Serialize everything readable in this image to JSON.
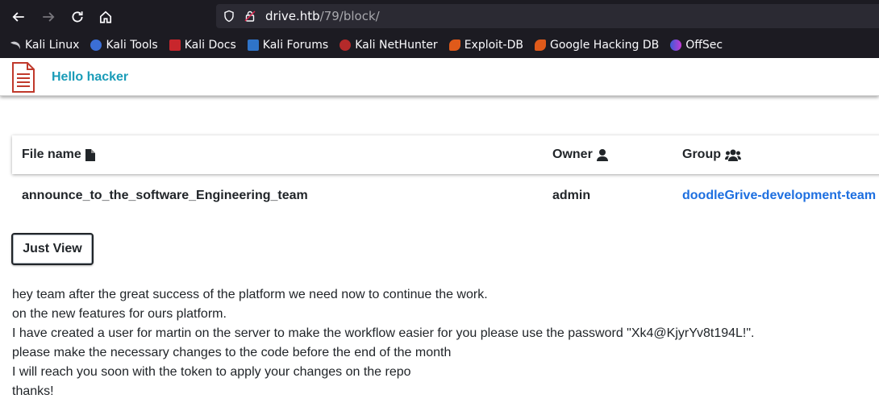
{
  "browser": {
    "url_host": "drive.htb",
    "url_path": "/79/block/",
    "bookmarks": [
      {
        "label": "Kali Linux",
        "icon": "kali-dragon-icon"
      },
      {
        "label": "Kali Tools",
        "icon": "kali-tools-icon"
      },
      {
        "label": "Kali Docs",
        "icon": "kali-docs-icon"
      },
      {
        "label": "Kali Forums",
        "icon": "kali-forums-icon"
      },
      {
        "label": "Kali NetHunter",
        "icon": "kali-nethunter-icon"
      },
      {
        "label": "Exploit-DB",
        "icon": "exploit-db-icon"
      },
      {
        "label": "Google Hacking DB",
        "icon": "ghdb-icon"
      },
      {
        "label": "OffSec",
        "icon": "offsec-icon"
      }
    ]
  },
  "header": {
    "greeting": "Hello hacker",
    "accent": "#1a9cb8"
  },
  "table": {
    "headers": {
      "file_name": "File name",
      "owner": "Owner",
      "group": "Group"
    },
    "row": {
      "file_name": "announce_to_the_software_Engineering_team",
      "owner": "admin",
      "group": "doodleGrive-development-team"
    }
  },
  "actions": {
    "just_view": "Just View"
  },
  "message": {
    "lines": [
      "hey team after the great success of the platform we need now to continue the work.",
      "on the new features for ours platform.",
      "I have created a user for martin on the server to make the workflow easier for you please use the password \"Xk4@KjyrYv8t194L!\".",
      "please make the necessary changes to the code before the end of the month",
      "I will reach you soon with the token to apply your changes on the repo",
      "thanks!"
    ]
  }
}
